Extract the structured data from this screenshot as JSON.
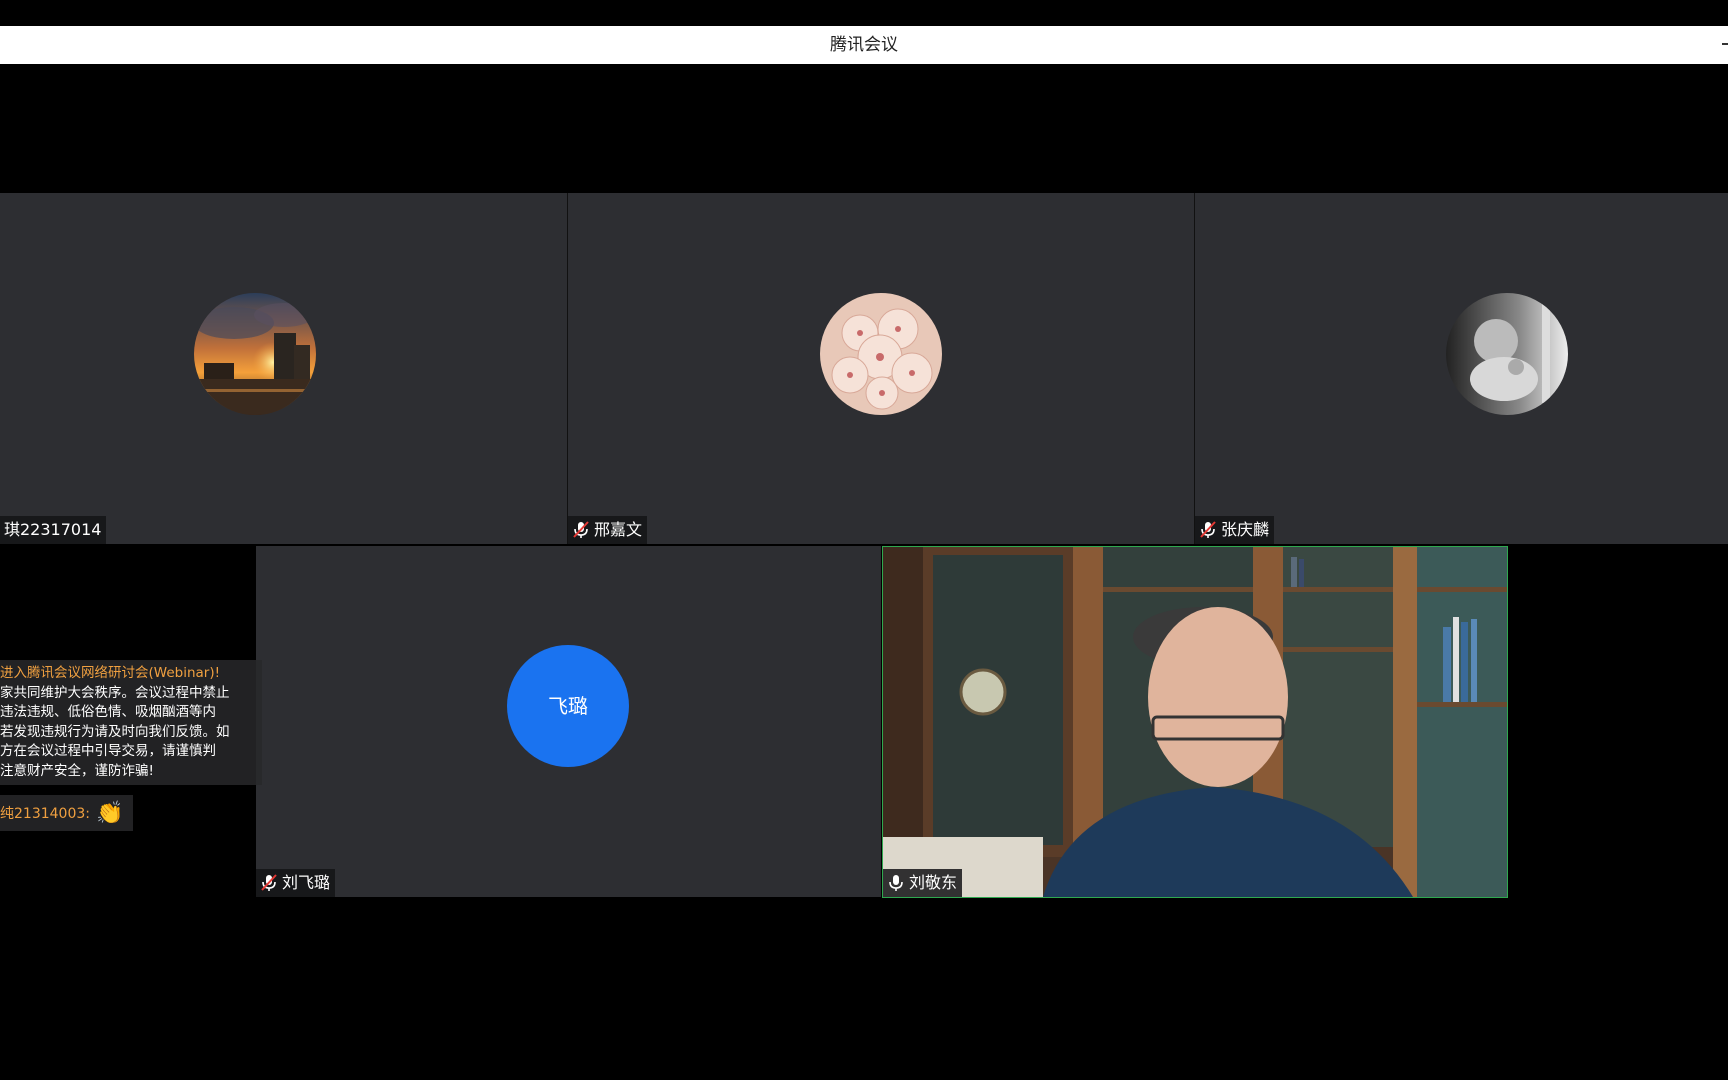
{
  "window": {
    "title": "腾讯会议"
  },
  "participants": {
    "p1": {
      "name": "琪22317014"
    },
    "p2": {
      "name": "邢嘉文"
    },
    "p3": {
      "name": "张庆麟"
    },
    "p4": {
      "name": "刘飞璐",
      "initials": "飞璐"
    },
    "p5": {
      "name": "刘敬东"
    }
  },
  "chat": {
    "notice_head": "进入腾讯会议网络研讨会(Webinar)!",
    "notice_lines": [
      "家共同维护大会秩序。会议过程中禁止",
      "违法违规、低俗色情、吸烟酗酒等内",
      "若发现违规行为请及时向我们反馈。如",
      "方在会议过程中引导交易，请谨慎判",
      "注意财产安全，谨防诈骗!"
    ],
    "message_sender": "纯21314003:",
    "message_icon": "clapping-hands-icon"
  },
  "colors": {
    "tile_bg": "#2d2e32",
    "active_speaker_border": "#2fa84f",
    "initials_avatar": "#1a73f0",
    "chat_accent": "#f0a040"
  }
}
